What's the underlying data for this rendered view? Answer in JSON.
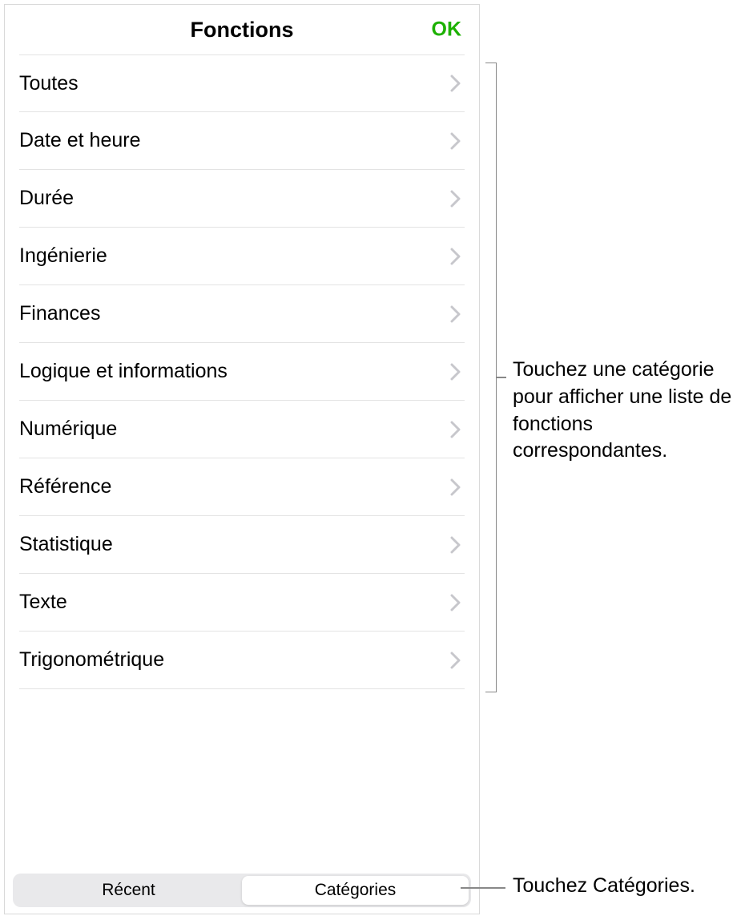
{
  "header": {
    "title": "Fonctions",
    "ok_label": "OK"
  },
  "categories": [
    {
      "label": "Toutes"
    },
    {
      "label": "Date et heure"
    },
    {
      "label": "Durée"
    },
    {
      "label": "Ingénierie"
    },
    {
      "label": "Finances"
    },
    {
      "label": "Logique et informations"
    },
    {
      "label": "Numérique"
    },
    {
      "label": "Référence"
    },
    {
      "label": "Statistique"
    },
    {
      "label": "Texte"
    },
    {
      "label": "Trigonométrique"
    }
  ],
  "tabs": {
    "recent": "Récent",
    "categories": "Catégories"
  },
  "callouts": {
    "list_text": "Touchez une catégorie pour afficher une liste de fonctions correspondantes.",
    "tabs_text": "Touchez Catégories."
  }
}
